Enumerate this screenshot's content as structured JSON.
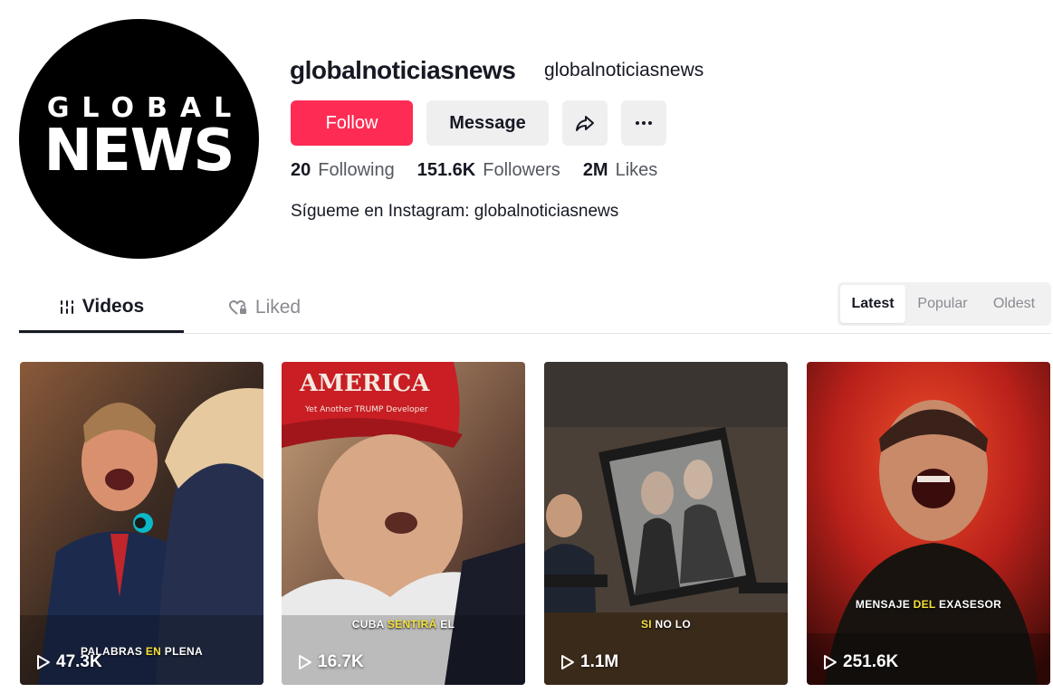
{
  "profile": {
    "avatar_text_line1": "GLOBAL",
    "avatar_text_line2": "NEWS",
    "username": "globalnoticiasnews",
    "nickname": "globalnoticiasnews",
    "bio": "Sígueme en Instagram: globalnoticiasnews"
  },
  "actions": {
    "follow_label": "Follow",
    "message_label": "Message",
    "share_icon": "share-icon",
    "more_icon": "more-icon"
  },
  "stats": {
    "following_count": "20",
    "following_label": "Following",
    "followers_count": "151.6K",
    "followers_label": "Followers",
    "likes_count": "2M",
    "likes_label": "Likes"
  },
  "tabs": [
    {
      "label": "Videos",
      "active": true
    },
    {
      "label": "Liked",
      "active": false
    }
  ],
  "sort": {
    "options": [
      "Latest",
      "Popular",
      "Oldest"
    ],
    "selected": "Latest"
  },
  "videos": [
    {
      "views": "47.3K",
      "caption_pre": "PALABRAS ",
      "caption_hl": "EN",
      "caption_post": " PLENA"
    },
    {
      "views": "16.7K",
      "caption_pre": "CUBA ",
      "caption_hl": "SENTIRÁ",
      "caption_post": " EL"
    },
    {
      "views": "1.1M",
      "caption_pre": "",
      "caption_hl": "SI",
      "caption_post": " NO LO"
    },
    {
      "views": "251.6K",
      "caption_pre": "MENSAJE ",
      "caption_hl": "DEL",
      "caption_post": " EXASESOR"
    }
  ],
  "colors": {
    "accent": "#fe2c55",
    "text": "#161823",
    "muted": "#8a8b91",
    "caption_highlight": "#f5e13a"
  }
}
